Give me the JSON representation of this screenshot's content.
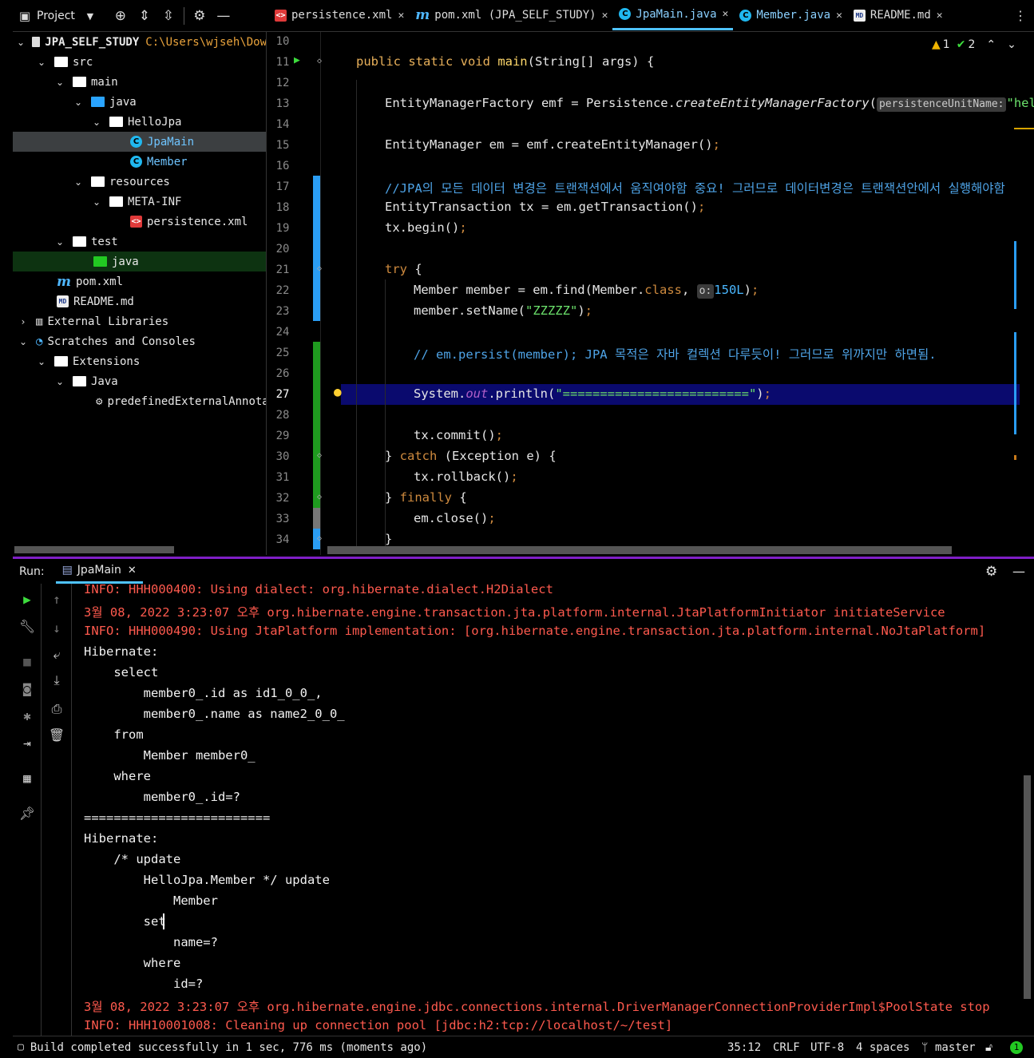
{
  "project_header": {
    "label": "Project"
  },
  "tabs": [
    {
      "label": "persistence.xml",
      "icon": "xml-file-icon"
    },
    {
      "label": "pom.xml (JPA_SELF_STUDY)",
      "icon": "maven-icon"
    },
    {
      "label": "JpaMain.java",
      "icon": "java-class-icon",
      "active": true
    },
    {
      "label": "Member.java",
      "icon": "java-class-icon"
    },
    {
      "label": "README.md",
      "icon": "markdown-icon"
    }
  ],
  "tree": {
    "root_name": "JPA_SELF_STUDY",
    "root_path": "C:\\Users\\wjseh\\Dow",
    "src": "src",
    "main": "main",
    "java": "java",
    "hellojpa": "HelloJpa",
    "jpamain": "JpaMain",
    "member": "Member",
    "resources": "resources",
    "metainf": "META-INF",
    "persistence": "persistence.xml",
    "test": "test",
    "test_java": "java",
    "pom": "pom.xml",
    "readme": "README.md",
    "ext_libs": "External Libraries",
    "scratches": "Scratches and Consoles",
    "extensions": "Extensions",
    "ext_java": "Java",
    "predefined": "predefinedExternalAnnotat"
  },
  "editor": {
    "line_numbers": [
      "10",
      "11",
      "12",
      "13",
      "14",
      "15",
      "16",
      "17",
      "18",
      "19",
      "20",
      "21",
      "22",
      "23",
      "24",
      "25",
      "26",
      "27",
      "28",
      "29",
      "30",
      "31",
      "32",
      "33",
      "34"
    ],
    "current_line": "27",
    "inspections": {
      "warnings": "1",
      "ok": "2"
    },
    "hints": {
      "persistence_unit": "persistenceUnitName:",
      "o": "o:"
    }
  },
  "run": {
    "label": "Run:",
    "tab": "JpaMain"
  },
  "console_lines": [
    {
      "t": "INFO: HHH000400: Using dialect: org.hibernate.dialect.H2Dialect",
      "red": true
    },
    {
      "t": "3월 08, 2022 3:23:07 오후 org.hibernate.engine.transaction.jta.platform.internal.JtaPlatformInitiator initiateService",
      "red": true
    },
    {
      "t": "INFO: HHH000490: Using JtaPlatform implementation: [org.hibernate.engine.transaction.jta.platform.internal.NoJtaPlatform]",
      "red": true
    },
    {
      "t": "Hibernate: ",
      "red": false
    },
    {
      "t": "    select",
      "red": false
    },
    {
      "t": "        member0_.id as id1_0_0_,",
      "red": false
    },
    {
      "t": "        member0_.name as name2_0_0_ ",
      "red": false
    },
    {
      "t": "    from",
      "red": false
    },
    {
      "t": "        Member member0_ ",
      "red": false
    },
    {
      "t": "    where",
      "red": false
    },
    {
      "t": "        member0_.id=?",
      "red": false
    },
    {
      "t": "=========================",
      "red": false
    },
    {
      "t": "Hibernate: ",
      "red": false
    },
    {
      "t": "    /* update",
      "red": false
    },
    {
      "t": "        HelloJpa.Member */ update",
      "red": false
    },
    {
      "t": "            Member ",
      "red": false
    },
    {
      "t": "        set",
      "red": false
    },
    {
      "t": "            name=? ",
      "red": false
    },
    {
      "t": "        where",
      "red": false
    },
    {
      "t": "            id=?",
      "red": false
    },
    {
      "t": "3월 08, 2022 3:23:07 오후 org.hibernate.engine.jdbc.connections.internal.DriverManagerConnectionProviderImpl$PoolState stop",
      "red": true
    },
    {
      "t": "INFO: HHH10001008: Cleaning up connection pool [jdbc:h2:tcp://localhost/~/test]",
      "red": true
    }
  ],
  "status": {
    "message": "Build completed successfully in 1 sec, 776 ms (moments ago)",
    "position": "35:12",
    "line_sep": "CRLF",
    "encoding": "UTF-8",
    "indent": "4 spaces",
    "branch": "master",
    "notifications": "1"
  }
}
